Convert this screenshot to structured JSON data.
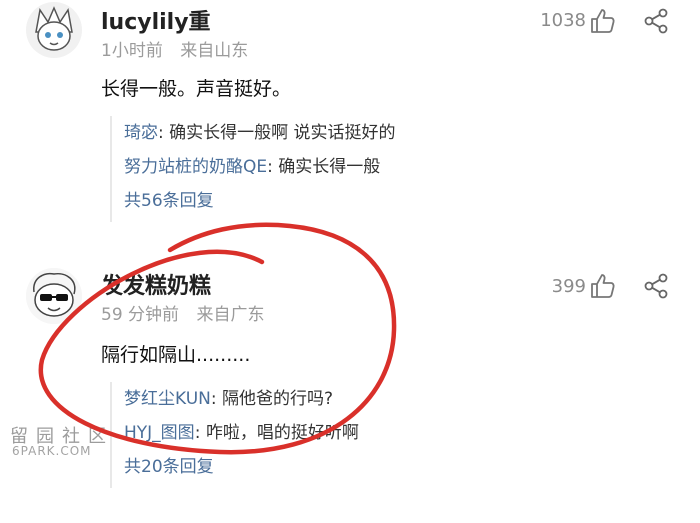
{
  "comments": [
    {
      "username": "lucylily重",
      "time": "1小时前",
      "location": "来自山东",
      "likes": "1038",
      "content": "长得一般。声音挺好。",
      "replies": [
        {
          "author": "琦宓",
          "text": ": 确实长得一般啊 说实话挺好的"
        },
        {
          "author": "努力站桩的奶酪QE",
          "text": ": 确实长得一般"
        }
      ],
      "total_replies": "共56条回复"
    },
    {
      "username": "发发糕奶糕",
      "time": "59 分钟前",
      "location": "来自广东",
      "likes": "399",
      "content": "隔行如隔山.........",
      "replies": [
        {
          "author": "梦红尘KUN",
          "text": ": 隔他爸的行吗?"
        },
        {
          "author": "HYJ_图图",
          "text": ": 咋啦，唱的挺好听啊"
        }
      ],
      "total_replies": "共20条回复"
    }
  ],
  "watermark": {
    "chars": "留园社区",
    "site": "6PARK.COM"
  },
  "colors": {
    "link": "#4a6e99",
    "annotation_circle": "#d9302a"
  }
}
